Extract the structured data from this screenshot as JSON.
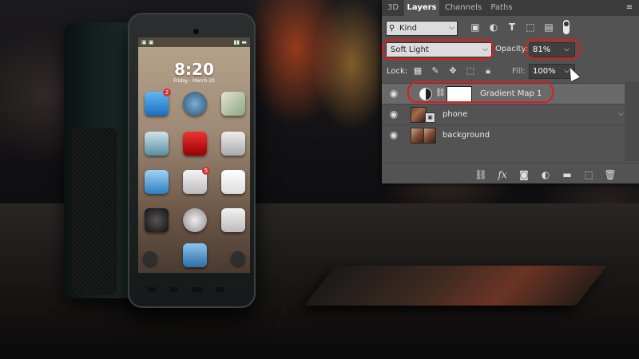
{
  "panel": {
    "tabs": [
      {
        "label": "3D"
      },
      {
        "label": "Layers"
      },
      {
        "label": "Channels"
      },
      {
        "label": "Paths"
      }
    ],
    "menu_glyph": "≡",
    "filter": {
      "kind_label": "Kind",
      "icons": [
        "image-filter-icon",
        "adjustment-filter-icon",
        "type-filter-icon",
        "shape-filter-icon",
        "smart-object-filter-icon"
      ]
    },
    "blend_mode": "Soft Light",
    "opacity_label": "Opacity:",
    "opacity_value": "81%",
    "lock_label": "Lock:",
    "lock_icons": [
      "lock-transparent-pixels-icon",
      "lock-image-pixels-icon",
      "lock-position-icon",
      "lock-artboard-icon",
      "lock-all-icon"
    ],
    "fill_label": "Fill:",
    "fill_value": "100%",
    "layers": [
      {
        "name": "Gradient Map 1",
        "type": "adjustment",
        "selected": true
      },
      {
        "name": "phone",
        "type": "smart-object",
        "selected": false
      },
      {
        "name": "background",
        "type": "pixel",
        "selected": false
      }
    ],
    "footer_icons": [
      "link-layers-icon",
      "fx-icon",
      "add-mask-icon",
      "new-adjustment-layer-icon",
      "new-group-icon",
      "new-layer-icon",
      "delete-layer-icon"
    ]
  },
  "phone": {
    "status_left": "▣ ▣",
    "status_right": "▮▮ ▬",
    "clock": "8:20",
    "date": "Friday · March 20",
    "badges": [
      "2",
      "5"
    ]
  },
  "colors": {
    "highlight": "#e01b1b",
    "panel_bg": "#535353",
    "tabbar_bg": "#3b3b3b"
  }
}
